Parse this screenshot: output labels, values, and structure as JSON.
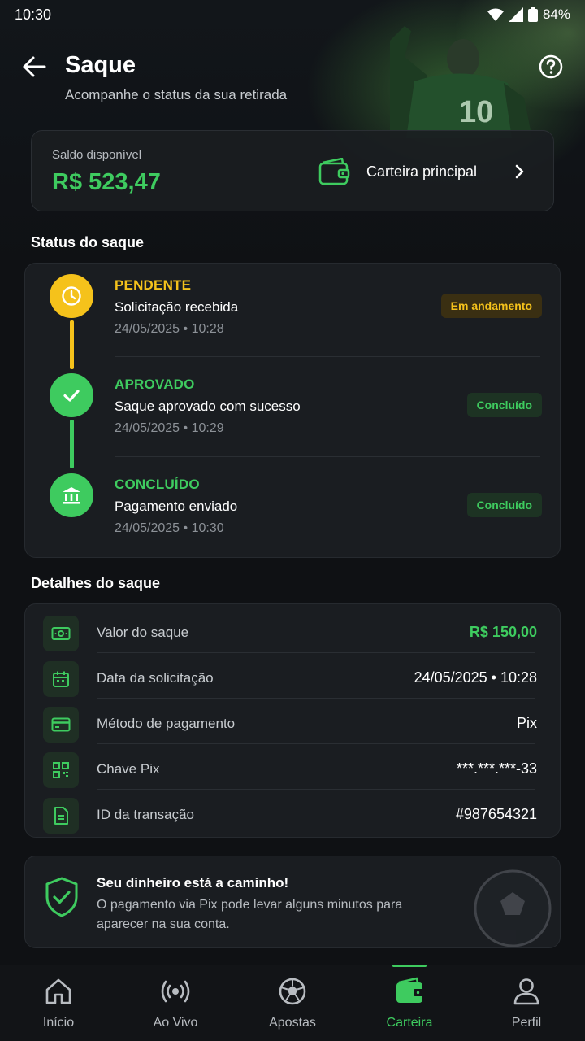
{
  "status_bar": {
    "time": "10:30",
    "battery": "84%"
  },
  "header": {
    "title": "Saque",
    "subtitle": "Acompanhe o status da sua retirada"
  },
  "balance": {
    "label": "Saldo disponível",
    "value": "R$ 523,47",
    "wallet_label": "Carteira principal"
  },
  "status_section": {
    "title": "Status do saque",
    "steps": [
      {
        "title": "PENDENTE",
        "description": "Solicitação recebida",
        "date": "24/05/2025 • 10:28",
        "badge": "Em andamento",
        "color": "#f5c21b"
      },
      {
        "title": "APROVADO",
        "description": "Saque aprovado com sucesso",
        "date": "24/05/2025 • 10:29",
        "badge": "Concluído",
        "color": "#3ecb5f"
      },
      {
        "title": "CONCLUÍDO",
        "description": "Pagamento enviado",
        "date": "24/05/2025 • 10:30",
        "badge": "Concluído",
        "color": "#3ecb5f"
      }
    ]
  },
  "details_section": {
    "title": "Detalhes do saque",
    "rows": [
      {
        "label": "Valor do saque",
        "value": "R$ 150,00",
        "icon": "cash-icon"
      },
      {
        "label": "Data da solicitação",
        "value": "24/05/2025 • 10:28",
        "icon": "calendar-icon"
      },
      {
        "label": "Método de pagamento",
        "value": "Pix",
        "icon": "card-icon"
      },
      {
        "label": "Chave Pix",
        "value": "***.***.***-33",
        "icon": "qr-code-icon"
      },
      {
        "label": "ID da transação",
        "value": "#987654321",
        "icon": "document-icon"
      }
    ]
  },
  "info": {
    "title": "Seu dinheiro está a caminho!",
    "text": "O pagamento via Pix pode levar alguns minutos para aparecer na sua conta."
  },
  "nav": {
    "items": [
      {
        "label": "Início",
        "icon": "home-icon"
      },
      {
        "label": "Ao Vivo",
        "icon": "live-icon"
      },
      {
        "label": "Apostas",
        "icon": "soccer-ball-icon"
      },
      {
        "label": "Carteira",
        "icon": "wallet-icon",
        "active": true
      },
      {
        "label": "Perfil",
        "icon": "user-icon"
      }
    ]
  },
  "colors": {
    "accent": "#3ecb5f",
    "pending": "#f5c21b",
    "background": "#0f1114",
    "card": "#1a1d21"
  }
}
